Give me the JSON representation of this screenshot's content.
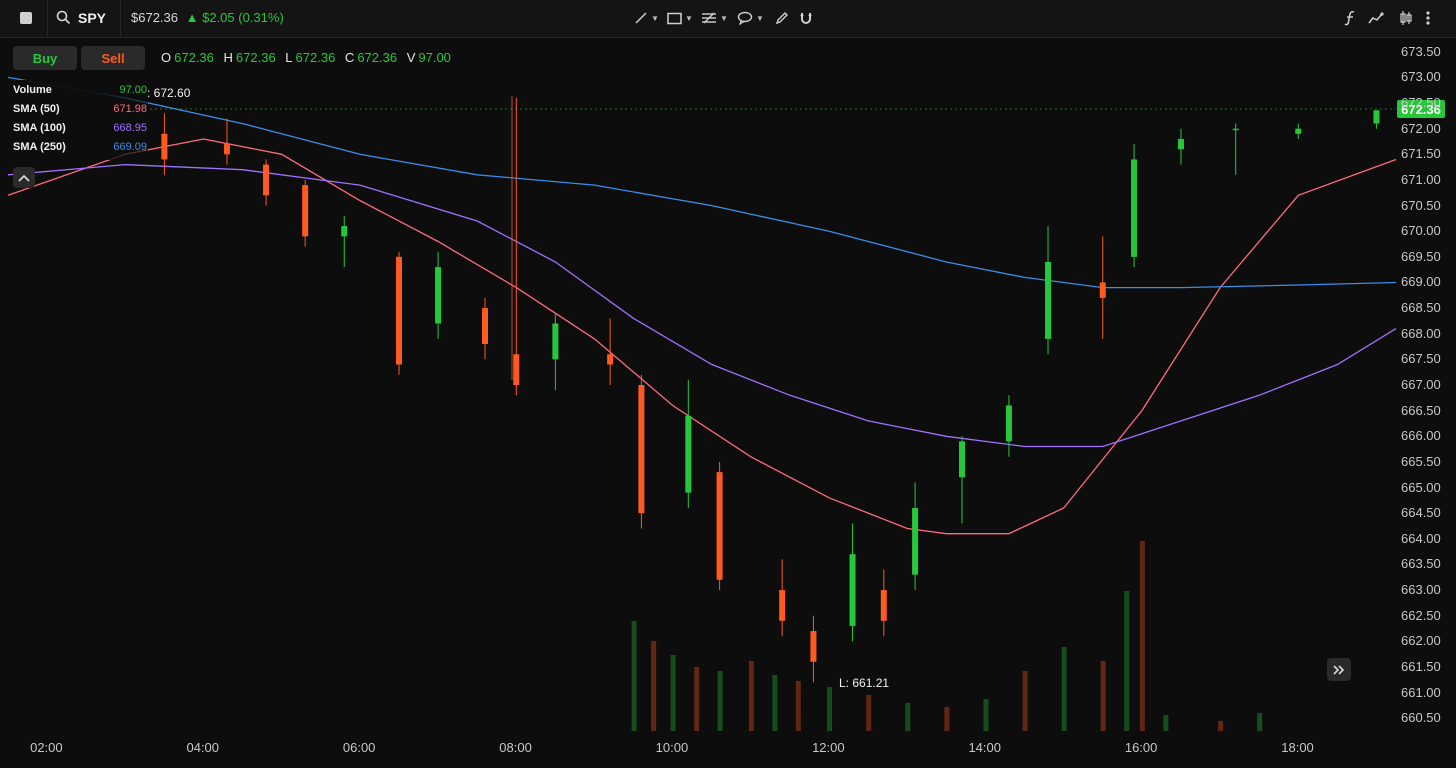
{
  "symbol": "SPY",
  "quote": {
    "price": "$672.36",
    "change": "$2.05 (0.31%)",
    "direction": "up"
  },
  "colors": {
    "up": "#26c83a",
    "down": "#ff5a1f",
    "sma50": "#ff6b7d",
    "sma100": "#a070ff",
    "sma250": "#3a8de8",
    "background": "#0d0d0d"
  },
  "toolbar": {
    "tools": [
      "line-tool-icon",
      "rectangle-tool-icon",
      "fib-tool-icon",
      "comment-tool-icon",
      "pencil-icon",
      "magnet-icon"
    ],
    "right_tools": [
      "indicator-icon",
      "chart-type-icon",
      "candle-style-icon",
      "more-vertical-icon"
    ]
  },
  "buttons": {
    "buy": "Buy",
    "sell": "Sell"
  },
  "ohlc": {
    "open_label": "O",
    "open": "672.36",
    "high_label": "H",
    "high": "672.36",
    "low_label": "L",
    "low": "672.36",
    "close_label": "C",
    "close": "672.36",
    "volume_label": "V",
    "volume": "97.00"
  },
  "legend": {
    "volume": {
      "name": "Volume",
      "value": "97.00"
    },
    "sma50": {
      "name": "SMA (50)",
      "value": "671.98"
    },
    "sma100": {
      "name": "SMA (100)",
      "value": "668.95"
    },
    "sma250": {
      "name": "SMA (250)",
      "value": "669.09"
    }
  },
  "hover_value": ": 672.60",
  "low_label": "L: 661.21",
  "last_price_tag": "672.36",
  "chart_data": {
    "type": "candlestick",
    "y_ticks": [
      "673.50",
      "673.00",
      "672.50",
      "672.00",
      "671.50",
      "671.00",
      "670.50",
      "670.00",
      "669.50",
      "669.00",
      "668.50",
      "668.00",
      "667.50",
      "667.00",
      "666.50",
      "666.00",
      "665.50",
      "665.00",
      "664.50",
      "664.00",
      "663.50",
      "663.00",
      "662.50",
      "662.00",
      "661.50",
      "661.00",
      "660.50"
    ],
    "x_ticks": [
      "02:00",
      "04:00",
      "06:00",
      "08:00",
      "10:00",
      "12:00",
      "14:00",
      "16:00",
      "18:00"
    ],
    "y_range": [
      660.25,
      673.75
    ],
    "x_range_hours": [
      1.5,
      19.25
    ],
    "last_price": 672.36,
    "candles": [
      {
        "t": 3.5,
        "o": 671.9,
        "h": 672.3,
        "l": 671.1,
        "c": 671.4
      },
      {
        "t": 4.3,
        "o": 671.7,
        "h": 672.2,
        "l": 671.3,
        "c": 671.5
      },
      {
        "t": 4.8,
        "o": 671.3,
        "h": 671.4,
        "l": 670.5,
        "c": 670.7
      },
      {
        "t": 5.3,
        "o": 670.9,
        "h": 671.0,
        "l": 669.7,
        "c": 669.9
      },
      {
        "t": 5.8,
        "o": 669.9,
        "h": 670.3,
        "l": 669.3,
        "c": 670.1
      },
      {
        "t": 6.5,
        "o": 669.5,
        "h": 669.6,
        "l": 667.2,
        "c": 667.4
      },
      {
        "t": 7.0,
        "o": 668.2,
        "h": 669.6,
        "l": 667.9,
        "c": 669.3
      },
      {
        "t": 7.6,
        "o": 668.5,
        "h": 668.7,
        "l": 667.5,
        "c": 667.8
      },
      {
        "t": 8.0,
        "o": 667.6,
        "h": 672.6,
        "l": 666.8,
        "c": 667.0
      },
      {
        "t": 8.5,
        "o": 667.5,
        "h": 668.4,
        "l": 666.9,
        "c": 668.2
      },
      {
        "t": 9.2,
        "o": 667.6,
        "h": 668.3,
        "l": 667.0,
        "c": 667.4
      },
      {
        "t": 9.6,
        "o": 667.0,
        "h": 667.2,
        "l": 664.2,
        "c": 664.5
      },
      {
        "t": 10.2,
        "o": 664.9,
        "h": 667.1,
        "l": 664.6,
        "c": 666.4
      },
      {
        "t": 10.6,
        "o": 665.3,
        "h": 665.5,
        "l": 663.0,
        "c": 663.2
      },
      {
        "t": 11.4,
        "o": 663.0,
        "h": 663.6,
        "l": 662.1,
        "c": 662.4
      },
      {
        "t": 11.8,
        "o": 662.2,
        "h": 662.5,
        "l": 661.2,
        "c": 661.6
      },
      {
        "t": 12.3,
        "o": 662.3,
        "h": 664.3,
        "l": 662.0,
        "c": 663.7
      },
      {
        "t": 12.7,
        "o": 663.0,
        "h": 663.4,
        "l": 662.1,
        "c": 662.4
      },
      {
        "t": 13.1,
        "o": 663.3,
        "h": 665.1,
        "l": 663.0,
        "c": 664.6
      },
      {
        "t": 13.7,
        "o": 665.2,
        "h": 666.0,
        "l": 664.3,
        "c": 665.9
      },
      {
        "t": 14.3,
        "o": 665.9,
        "h": 666.8,
        "l": 665.6,
        "c": 666.6
      },
      {
        "t": 14.8,
        "o": 667.9,
        "h": 670.1,
        "l": 667.6,
        "c": 669.4
      },
      {
        "t": 15.5,
        "o": 669.0,
        "h": 669.9,
        "l": 667.9,
        "c": 668.7
      },
      {
        "t": 15.9,
        "o": 669.5,
        "h": 671.7,
        "l": 669.3,
        "c": 671.4
      },
      {
        "t": 16.5,
        "o": 671.6,
        "h": 672.0,
        "l": 671.3,
        "c": 671.8
      },
      {
        "t": 17.2,
        "o": 672.0,
        "h": 672.1,
        "l": 671.1,
        "c": 672.0
      },
      {
        "t": 18.0,
        "o": 671.9,
        "h": 672.1,
        "l": 671.8,
        "c": 672.0
      },
      {
        "t": 19.0,
        "o": 672.1,
        "h": 672.3,
        "l": 672.0,
        "c": 672.36
      }
    ],
    "series": [
      {
        "name": "SMA (50)",
        "points": [
          [
            1.5,
            670.7
          ],
          [
            3.0,
            671.5
          ],
          [
            4.0,
            671.8
          ],
          [
            5.0,
            671.5
          ],
          [
            6.0,
            670.6
          ],
          [
            7.0,
            669.8
          ],
          [
            8.0,
            668.9
          ],
          [
            9.0,
            667.9
          ],
          [
            10.0,
            666.6
          ],
          [
            11.0,
            665.6
          ],
          [
            12.0,
            664.8
          ],
          [
            13.0,
            664.2
          ],
          [
            13.5,
            664.1
          ],
          [
            14.3,
            664.1
          ],
          [
            15.0,
            664.6
          ],
          [
            16.0,
            666.5
          ],
          [
            17.0,
            668.9
          ],
          [
            18.0,
            670.7
          ],
          [
            19.25,
            671.4
          ]
        ]
      },
      {
        "name": "SMA (100)",
        "points": [
          [
            1.5,
            671.1
          ],
          [
            3.0,
            671.3
          ],
          [
            4.5,
            671.2
          ],
          [
            6.0,
            670.9
          ],
          [
            7.5,
            670.2
          ],
          [
            8.5,
            669.4
          ],
          [
            9.5,
            668.3
          ],
          [
            10.5,
            667.4
          ],
          [
            11.5,
            666.8
          ],
          [
            12.5,
            666.3
          ],
          [
            13.5,
            666.0
          ],
          [
            14.5,
            665.8
          ],
          [
            15.5,
            665.8
          ],
          [
            16.5,
            666.3
          ],
          [
            17.5,
            666.8
          ],
          [
            18.5,
            667.4
          ],
          [
            19.25,
            668.1
          ]
        ]
      },
      {
        "name": "SMA (250)",
        "points": [
          [
            1.5,
            673.0
          ],
          [
            3.0,
            672.6
          ],
          [
            4.5,
            672.1
          ],
          [
            6.0,
            671.5
          ],
          [
            7.5,
            671.1
          ],
          [
            9.0,
            670.9
          ],
          [
            10.5,
            670.5
          ],
          [
            12.0,
            670.0
          ],
          [
            13.5,
            669.4
          ],
          [
            14.5,
            669.1
          ],
          [
            15.5,
            668.9
          ],
          [
            16.5,
            668.9
          ],
          [
            18.0,
            668.95
          ],
          [
            19.25,
            669.0
          ]
        ]
      }
    ],
    "volume": [
      {
        "t": 9.5,
        "v": 0.55
      },
      {
        "t": 9.75,
        "v": 0.45
      },
      {
        "t": 10.0,
        "v": 0.38
      },
      {
        "t": 10.3,
        "v": 0.32
      },
      {
        "t": 10.6,
        "v": 0.3
      },
      {
        "t": 11.0,
        "v": 0.35
      },
      {
        "t": 11.3,
        "v": 0.28
      },
      {
        "t": 11.6,
        "v": 0.25
      },
      {
        "t": 12.0,
        "v": 0.22
      },
      {
        "t": 12.5,
        "v": 0.18
      },
      {
        "t": 13.0,
        "v": 0.14
      },
      {
        "t": 13.5,
        "v": 0.12
      },
      {
        "t": 14.0,
        "v": 0.16
      },
      {
        "t": 14.5,
        "v": 0.3
      },
      {
        "t": 15.0,
        "v": 0.42
      },
      {
        "t": 15.5,
        "v": 0.35
      },
      {
        "t": 15.8,
        "v": 0.7
      },
      {
        "t": 16.0,
        "v": 0.95
      },
      {
        "t": 16.3,
        "v": 0.08
      },
      {
        "t": 17.0,
        "v": 0.05
      },
      {
        "t": 17.5,
        "v": 0.09
      }
    ]
  }
}
